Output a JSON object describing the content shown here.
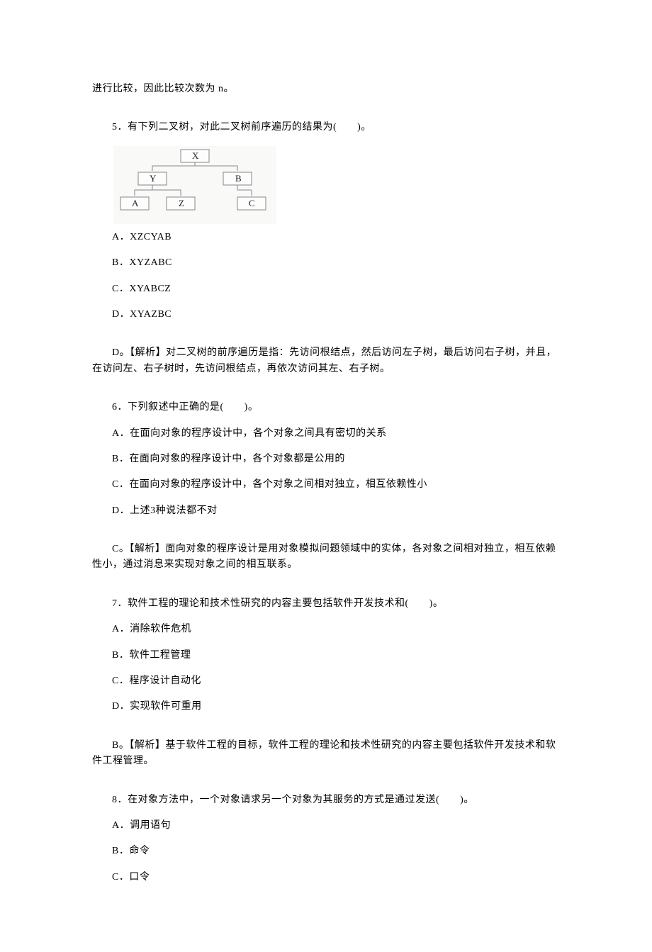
{
  "top_fragment": "进行比较，因此比较次数为 n。",
  "q5": {
    "stem": "5．有下列二叉树，对此二叉树前序遍历的结果为(　　)。",
    "optA": "A．XZCYAB",
    "optB": "B．XYZABC",
    "optC": "C．XYABCZ",
    "optD": "D．XYAZBC",
    "answer": "D。【解析】对二叉树的前序遍历是指：先访问根结点，然后访问左子树，最后访问右子树，并且，在访问左、右子树时，先访问根结点，再依次访问其左、右子树。"
  },
  "q6": {
    "stem": "6．下列叙述中正确的是(　　)。",
    "optA": "A．在面向对象的程序设计中，各个对象之间具有密切的关系",
    "optB": "B．在面向对象的程序设计中，各个对象都是公用的",
    "optC": "C．在面向对象的程序设计中，各个对象之间相对独立，相互依赖性小",
    "optD": "D．上述3种说法都不对",
    "answer": "C。【解析】面向对象的程序设计是用对象模拟问题领域中的实体，各对象之间相对独立，相互依赖性小，通过消息来实现对象之间的相互联系。"
  },
  "q7": {
    "stem": "7．软件工程的理论和技术性研究的内容主要包括软件开发技术和(　　)。",
    "optA": "A．消除软件危机",
    "optB": "B．软件工程管理",
    "optC": "C．程序设计自动化",
    "optD": "D．实现软件可重用",
    "answer": "B。【解析】基于软件工程的目标，软件工程的理论和技术性研究的内容主要包括软件开发技术和软件工程管理。"
  },
  "q8": {
    "stem": "8．在对象方法中，一个对象请求另一个对象为其服务的方式是通过发送(　　)。",
    "optA": "A．调用语句",
    "optB": "B．命令",
    "optC": "C．口令"
  },
  "tree": {
    "root": "X",
    "left": "Y",
    "right": "B",
    "ll": "A",
    "lr": "Z",
    "rr": "C"
  }
}
